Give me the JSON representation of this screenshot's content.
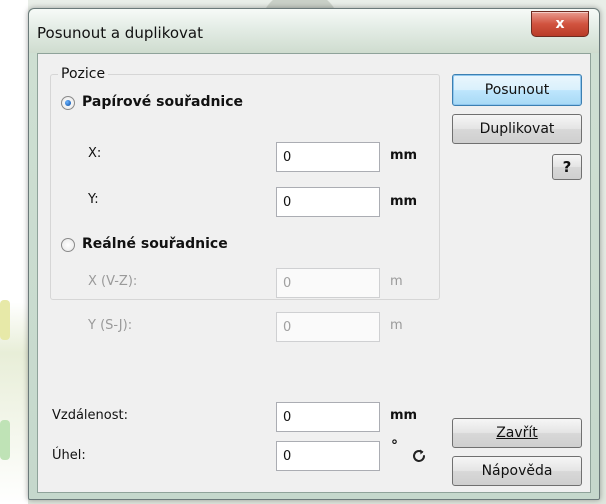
{
  "window": {
    "title": "Posunout a duplikovat",
    "close_label": "x"
  },
  "position_group": {
    "legend": "Pozice",
    "paper": {
      "label": "Papírové souřadnice",
      "selected": true,
      "x_label": "X:",
      "x_value": "0",
      "x_unit": "mm",
      "y_label": "Y:",
      "y_value": "0",
      "y_unit": "mm"
    },
    "real": {
      "label": "Reálné souřadnice",
      "selected": false,
      "x_label": "X (V-Z):",
      "x_value": "0",
      "x_unit": "m",
      "y_label": "Y (S-J):",
      "y_value": "0",
      "y_unit": "m"
    }
  },
  "distance": {
    "label": "Vzdálenost:",
    "value": "0",
    "unit": "mm"
  },
  "angle": {
    "label": "Úhel:",
    "value": "0",
    "unit": "°"
  },
  "buttons": {
    "move": "Posunout",
    "duplicate": "Duplikovat",
    "help_q": "?",
    "close": "Zavřít",
    "help": "Nápověda"
  },
  "icons": {
    "reset": "reset-icon",
    "help": "question-icon",
    "close": "close-icon"
  }
}
